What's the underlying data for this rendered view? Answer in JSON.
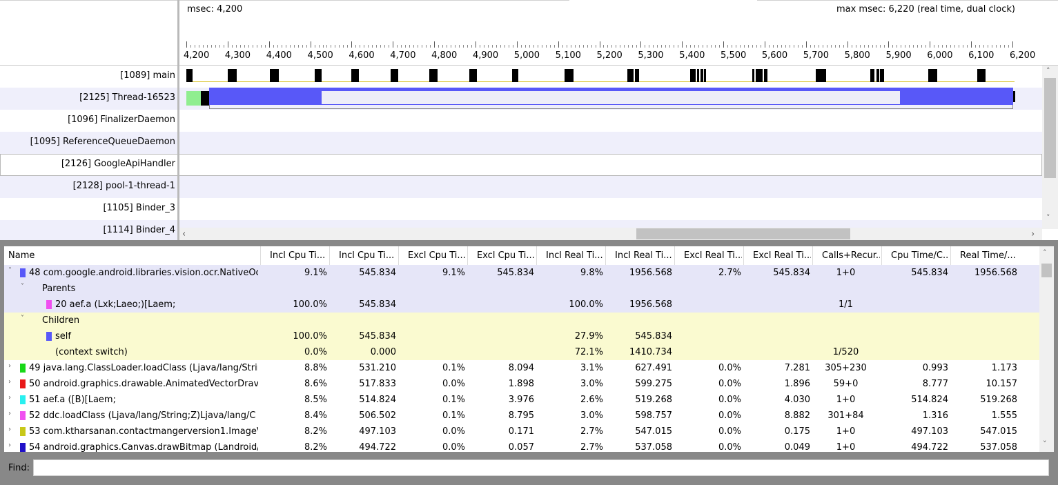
{
  "timeline": {
    "msec_label": "msec: 4,200",
    "max_label": "max msec: 6,220 (real time, dual clock)",
    "ticks": [
      "4,200",
      "4,300",
      "4,400",
      "4,500",
      "4,600",
      "4,700",
      "4,800",
      "4,900",
      "5,000",
      "5,100",
      "5,200",
      "5,300",
      "5,400",
      "5,500",
      "5,600",
      "5,700",
      "5,800",
      "5,900",
      "6,000",
      "6,100",
      "6,200"
    ],
    "threads": [
      {
        "name": "[1089] main"
      },
      {
        "name": "[2125] Thread-16523"
      },
      {
        "name": "[1096] FinalizerDaemon"
      },
      {
        "name": "[1095] ReferenceQueueDaemon"
      },
      {
        "name": "[2126] GoogleApiHandler"
      },
      {
        "name": "[2128] pool-1-thread-1"
      },
      {
        "name": "[1105] Binder_3"
      },
      {
        "name": "[1114] Binder_4"
      }
    ],
    "colors": {
      "method_blue": "#5858f8",
      "method_green": "#90ee90",
      "alt_row": "#efeffb"
    }
  },
  "table": {
    "columns": [
      "Name",
      "Incl Cpu Ti...",
      "Incl Cpu Ti...",
      "Excl Cpu Ti...",
      "Excl Cpu Ti...",
      "Incl Real Ti...",
      "Incl Real Ti...",
      "Excl Real Ti...",
      "Excl Real Ti...",
      "Calls+Recur...",
      "Cpu Time/C...",
      "Real Time/..."
    ],
    "rows": [
      {
        "name": "48 com.google.android.libraries.vision.ocr.NativeOc",
        "color": "#5858f8",
        "indent": 0,
        "expand": "open",
        "bg": "#e6e6f8",
        "values": [
          "9.1%",
          "545.834",
          "9.1%",
          "545.834",
          "9.8%",
          "1956.568",
          "2.7%",
          "545.834",
          "1+0",
          "545.834",
          "1956.568"
        ]
      },
      {
        "name": "Parents",
        "color": "",
        "indent": 1,
        "expand": "open",
        "bg": "#e6e6f8",
        "values": [
          "",
          "",
          "",
          "",
          "",
          "",
          "",
          "",
          "",
          "",
          ""
        ]
      },
      {
        "name": "20 aef.a (Lxk;Laeo;)[Laem;",
        "color": "#f050f0",
        "indent": 2,
        "expand": "",
        "bg": "#e6e6f8",
        "values": [
          "100.0%",
          "545.834",
          "",
          "",
          "100.0%",
          "1956.568",
          "",
          "",
          "1/1",
          "",
          ""
        ]
      },
      {
        "name": "Children",
        "color": "",
        "indent": 1,
        "expand": "open",
        "bg": "#fafad0",
        "values": [
          "",
          "",
          "",
          "",
          "",
          "",
          "",
          "",
          "",
          "",
          ""
        ]
      },
      {
        "name": "self",
        "color": "#5858f8",
        "indent": 2,
        "expand": "",
        "bg": "#fafad0",
        "values": [
          "100.0%",
          "545.834",
          "",
          "",
          "27.9%",
          "545.834",
          "",
          "",
          "",
          "",
          ""
        ]
      },
      {
        "name": "(context switch)",
        "color": "",
        "indent": 2,
        "expand": "",
        "bg": "#fafad0",
        "values": [
          "0.0%",
          "0.000",
          "",
          "",
          "72.1%",
          "1410.734",
          "",
          "",
          "1/520",
          "",
          ""
        ]
      },
      {
        "name": "49 java.lang.ClassLoader.loadClass (Ljava/lang/Strir",
        "color": "#18d818",
        "indent": 0,
        "expand": "closed",
        "bg": "#ffffff",
        "values": [
          "8.8%",
          "531.210",
          "0.1%",
          "8.094",
          "3.1%",
          "627.491",
          "0.0%",
          "7.281",
          "305+230",
          "0.993",
          "1.173"
        ]
      },
      {
        "name": "50 android.graphics.drawable.AnimatedVectorDrav",
        "color": "#e81818",
        "indent": 0,
        "expand": "closed",
        "bg": "#ffffff",
        "values": [
          "8.6%",
          "517.833",
          "0.0%",
          "1.898",
          "3.0%",
          "599.275",
          "0.0%",
          "1.896",
          "59+0",
          "8.777",
          "10.157"
        ]
      },
      {
        "name": "51 aef.a ([B)[Laem;",
        "color": "#28f0f0",
        "indent": 0,
        "expand": "closed",
        "bg": "#ffffff",
        "values": [
          "8.5%",
          "514.824",
          "0.1%",
          "3.976",
          "2.6%",
          "519.268",
          "0.0%",
          "4.030",
          "1+0",
          "514.824",
          "519.268"
        ]
      },
      {
        "name": "52 ddc.loadClass (Ljava/lang/String;Z)Ljava/lang/C",
        "color": "#f050f0",
        "indent": 0,
        "expand": "closed",
        "bg": "#ffffff",
        "values": [
          "8.4%",
          "506.502",
          "0.1%",
          "8.795",
          "3.0%",
          "598.757",
          "0.0%",
          "8.882",
          "301+84",
          "1.316",
          "1.555"
        ]
      },
      {
        "name": "53 com.ktharsanan.contactmangerversion1.ImageV",
        "color": "#c8c818",
        "indent": 0,
        "expand": "closed",
        "bg": "#ffffff",
        "values": [
          "8.2%",
          "497.103",
          "0.0%",
          "0.171",
          "2.7%",
          "547.015",
          "0.0%",
          "0.175",
          "1+0",
          "497.103",
          "547.015"
        ]
      },
      {
        "name": "54 android.graphics.Canvas.drawBitmap (Landroid/",
        "color": "#2010c8",
        "indent": 0,
        "expand": "closed",
        "bg": "#ffffff",
        "values": [
          "8.2%",
          "494.722",
          "0.0%",
          "0.057",
          "2.7%",
          "537.058",
          "0.0%",
          "0.049",
          "1+0",
          "494.722",
          "537.058"
        ]
      }
    ]
  },
  "find": {
    "label": "Find:",
    "value": ""
  }
}
